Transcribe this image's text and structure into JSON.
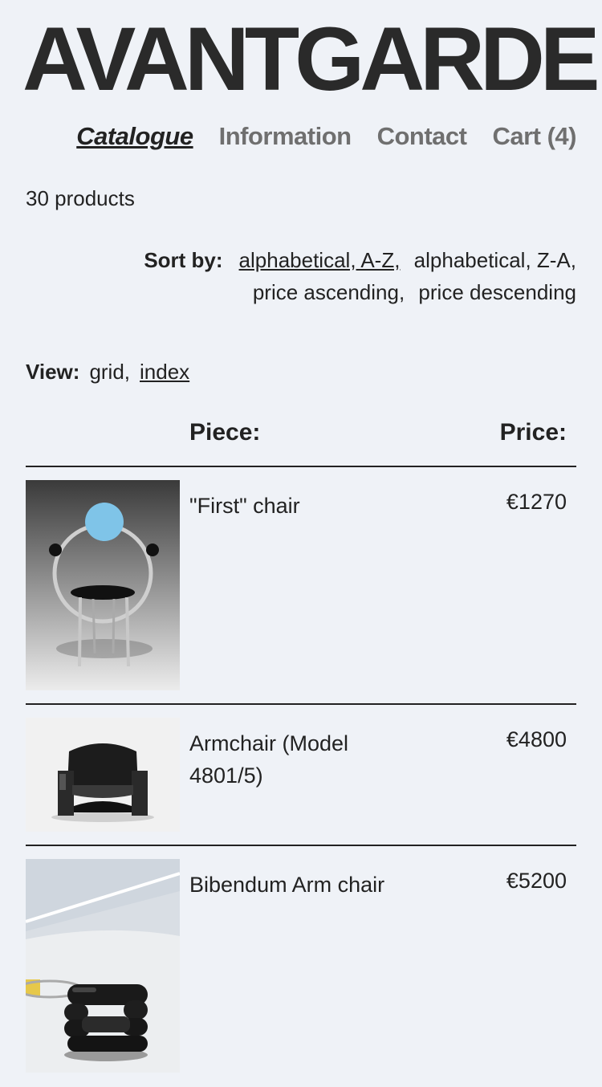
{
  "brand": "AVANTGARDE",
  "nav": [
    {
      "label": "Catalogue",
      "active": true
    },
    {
      "label": "Information",
      "active": false
    },
    {
      "label": "Contact",
      "active": false
    },
    {
      "label": "Cart (4)",
      "active": false
    }
  ],
  "product_count": "30 products",
  "sort": {
    "label": "Sort by:",
    "options": [
      "alphabetical, A-Z,",
      "alphabetical, Z-A,",
      "price ascending,",
      "price descending"
    ]
  },
  "view": {
    "label": "View:",
    "options": [
      "grid,",
      "index"
    ]
  },
  "table": {
    "piece_header": "Piece:",
    "price_header": "Price:"
  },
  "products": [
    {
      "name": "\"First\" chair",
      "price": "€1270"
    },
    {
      "name": "Armchair (Model 4801/5)",
      "price": "€4800"
    },
    {
      "name": "Bibendum Arm chair",
      "price": "€5200"
    }
  ]
}
